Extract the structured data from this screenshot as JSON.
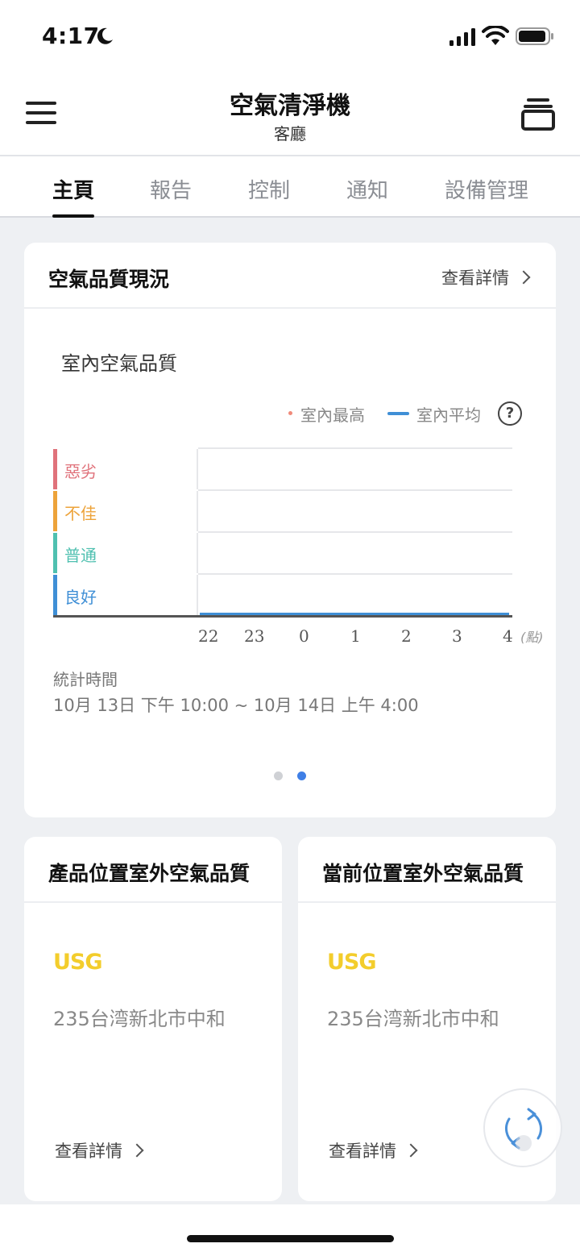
{
  "status_bar": {
    "time": "4:17",
    "icons": [
      "moon-icon",
      "signal-icon",
      "wifi-icon",
      "battery-icon"
    ]
  },
  "app_bar": {
    "title": "空氣清淨機",
    "subtitle": "客廳",
    "left_icon": "hamburger-menu-icon",
    "right_icon": "device-stack-icon"
  },
  "tabs": [
    {
      "label": "主頁",
      "active": true
    },
    {
      "label": "報告",
      "active": false
    },
    {
      "label": "控制",
      "active": false
    },
    {
      "label": "通知",
      "active": false
    },
    {
      "label": "設備管理",
      "active": false
    }
  ],
  "air_quality_card": {
    "title": "空氣品質現況",
    "detail_label": "查看詳情",
    "chart_title": "室內空氣品質",
    "legend_max": "室內最高",
    "legend_avg": "室內平均",
    "help_symbol": "?",
    "stat_label": "統計時間",
    "stat_range": "10月 13日 下午 10:00 ~ 10月 14日 上午 4:00",
    "pager": {
      "count": 2,
      "active_index": 1
    }
  },
  "chart_data": {
    "type": "line",
    "levels": [
      {
        "label": "惡劣",
        "color": "#e0727b"
      },
      {
        "label": "不佳",
        "color": "#eda33a"
      },
      {
        "label": "普通",
        "color": "#4fc0b0"
      },
      {
        "label": "良好",
        "color": "#3f8fd6"
      }
    ],
    "x": [
      "22",
      "23",
      "0",
      "1",
      "2",
      "3",
      "4"
    ],
    "x_unit": "(點)",
    "series": [
      {
        "name": "室內最高",
        "color": "#f08a7a",
        "values": []
      },
      {
        "name": "室內平均",
        "color": "#3f8fd6",
        "level": "良好"
      }
    ]
  },
  "outdoor_cards": [
    {
      "title": "產品位置室外空氣品質",
      "aqi_label": "USG",
      "address": "235台湾新北市中和",
      "detail_label": "查看詳情"
    },
    {
      "title": "當前位置室外空氣品質",
      "aqi_label": "USG",
      "address": "235台湾新北市中和",
      "detail_label": "查看詳情"
    }
  ],
  "colors": {
    "accent": "#3f8fd6",
    "usg": "#f3cd2c",
    "background": "#eef0f3"
  },
  "fab_icon": "refresh-icon"
}
